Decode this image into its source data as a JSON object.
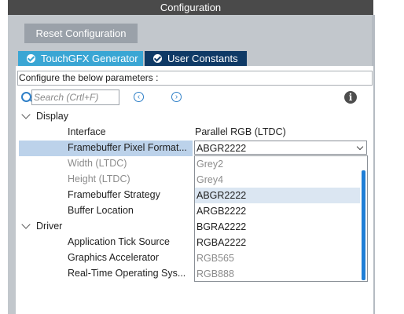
{
  "window": {
    "title": "Configuration"
  },
  "toolbar": {
    "reset_label": "Reset Configuration"
  },
  "tabs": [
    {
      "label": "TouchGFX Generator",
      "icon": "check-circle-icon",
      "color": "#3aa6d4"
    },
    {
      "label": "User Constants",
      "icon": "check-circle-icon",
      "color": "#0f3a66"
    }
  ],
  "description": "Configure the below parameters :",
  "search": {
    "placeholder": "Search (Crtl+F)",
    "value": ""
  },
  "groups": [
    {
      "label": "Display",
      "rows": [
        {
          "label": "Interface",
          "value": "Parallel RGB (LTDC)",
          "disabled": false
        },
        {
          "label": "Framebuffer Pixel Format...",
          "value": "ABGR2222",
          "disabled": false,
          "selected": true
        },
        {
          "label": "Width (LTDC)",
          "value": "",
          "disabled": true
        },
        {
          "label": "Height (LTDC)",
          "value": "",
          "disabled": true
        },
        {
          "label": "Framebuffer Strategy",
          "value": "",
          "disabled": false
        },
        {
          "label": "Buffer Location",
          "value": "",
          "disabled": false
        }
      ]
    },
    {
      "label": "Driver",
      "rows": [
        {
          "label": "Application Tick Source",
          "value": "",
          "disabled": false
        },
        {
          "label": "Graphics Accelerator",
          "value": "",
          "disabled": false
        },
        {
          "label": "Real-Time Operating Sys...",
          "value": "",
          "disabled": false
        }
      ]
    }
  ],
  "pixel_format_dropdown": {
    "selected": "ABGR2222",
    "options": [
      {
        "label": "Grey2",
        "disabled": true
      },
      {
        "label": "Grey4",
        "disabled": true
      },
      {
        "label": "ABGR2222",
        "disabled": false,
        "selected": true
      },
      {
        "label": "ARGB2222",
        "disabled": false
      },
      {
        "label": "BGRA2222",
        "disabled": false
      },
      {
        "label": "RGBA2222",
        "disabled": false
      },
      {
        "label": "RGB565",
        "disabled": true
      },
      {
        "label": "RGB888",
        "disabled": true
      }
    ]
  }
}
